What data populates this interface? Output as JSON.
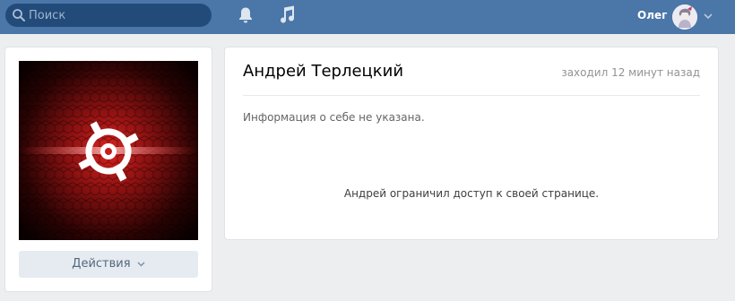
{
  "header": {
    "search": {
      "placeholder": "Поиск",
      "value": ""
    },
    "icons": {
      "search": "search-icon",
      "notifications": "bell-icon",
      "music": "music-note-icon",
      "menu": "chevron-down-icon"
    },
    "user": {
      "name": "Олег"
    },
    "colors": {
      "bar": "#4a76a8",
      "search_bg": "#224b7a"
    }
  },
  "profile": {
    "name": "Андрей Терлецкий",
    "last_seen": "заходил 12 минут назад",
    "about": "Информация о себе не указана.",
    "restricted_message": "Андрей ограничил доступ к своей странице.",
    "actions_label": "Действия"
  }
}
